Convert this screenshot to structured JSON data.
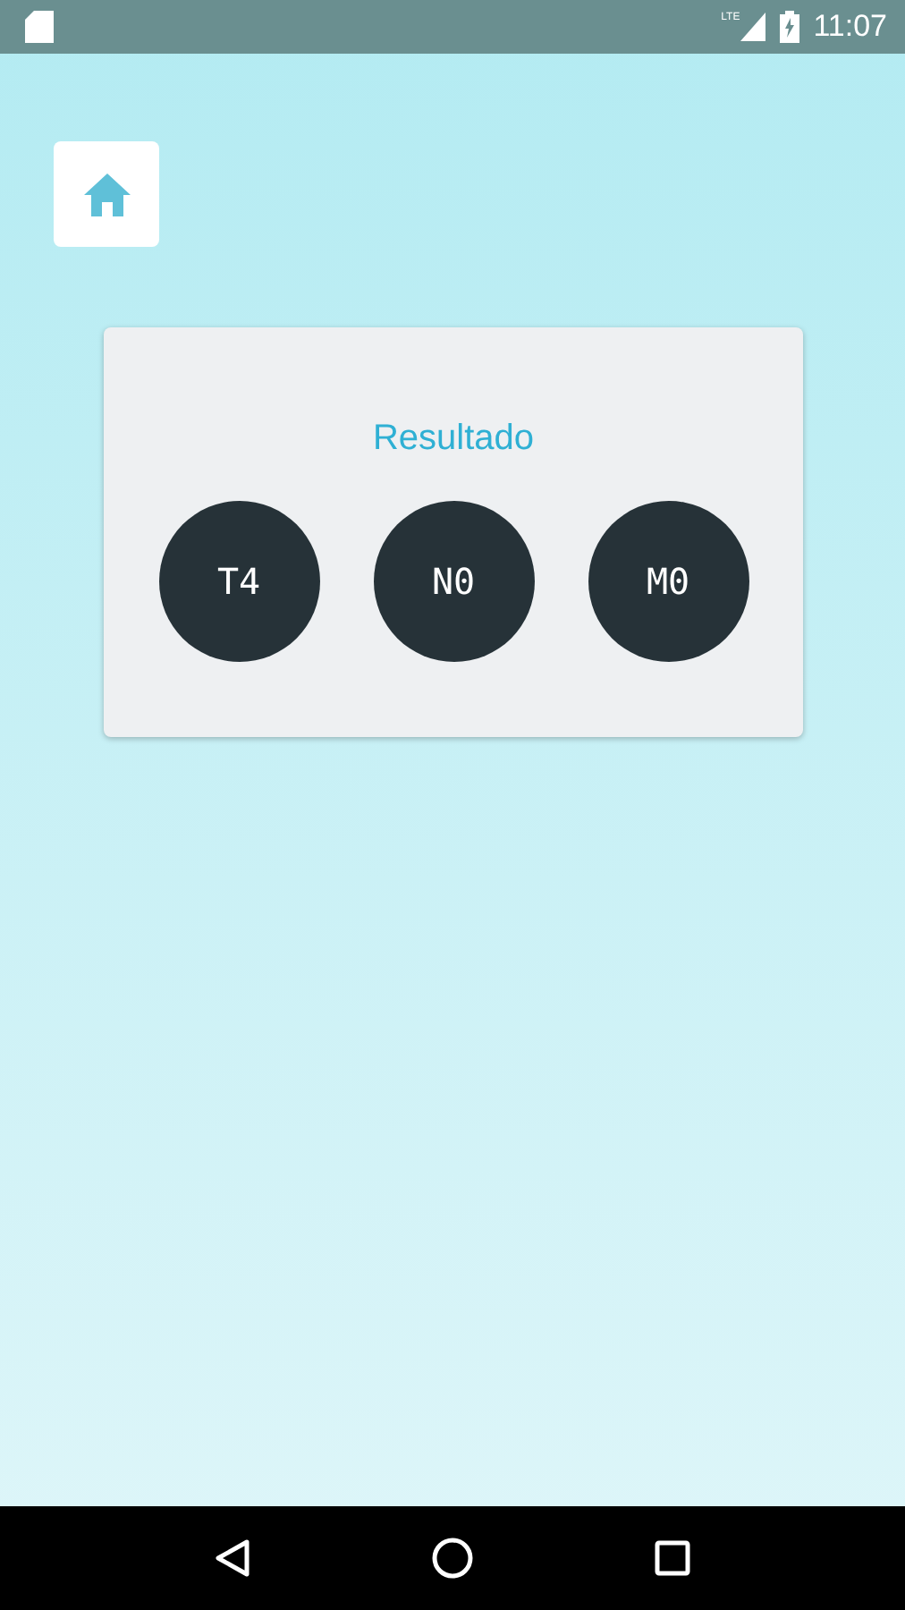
{
  "status_bar": {
    "network": "LTE",
    "time": "11:07"
  },
  "card": {
    "title": "Resultado",
    "results": [
      "T4",
      "N0",
      "M0"
    ]
  }
}
